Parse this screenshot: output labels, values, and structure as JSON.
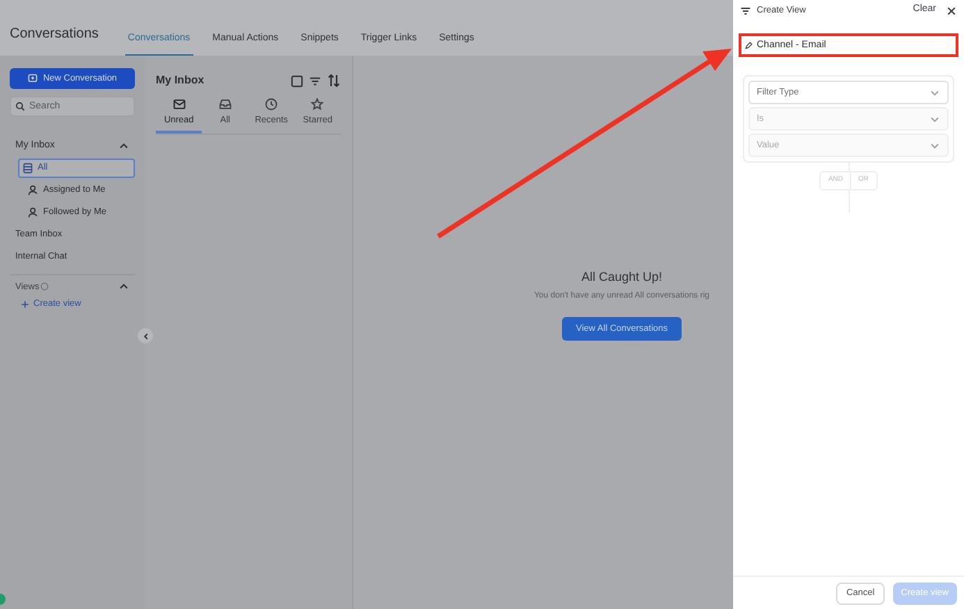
{
  "app": {
    "title": "Conversations"
  },
  "nav_tabs": [
    {
      "label": "Conversations",
      "selected": true
    },
    {
      "label": "Manual Actions",
      "selected": false
    },
    {
      "label": "Snippets",
      "selected": false
    },
    {
      "label": "Trigger Links",
      "selected": false
    },
    {
      "label": "Settings",
      "selected": false
    }
  ],
  "sidebar": {
    "new_button": "New Conversation",
    "search": {
      "placeholder": "Search"
    },
    "my_inbox": {
      "label": "My Inbox",
      "expanded": true,
      "items": [
        {
          "label": "All",
          "kind": "all",
          "selected": true
        },
        {
          "label": "Assigned to Me",
          "kind": "person",
          "selected": false
        },
        {
          "label": "Followed by Me",
          "kind": "person",
          "selected": false
        }
      ]
    },
    "sections": [
      "Team Inbox",
      "Internal Chat"
    ],
    "views": {
      "label": "Views",
      "expanded": true,
      "create": "Create view"
    }
  },
  "inbox": {
    "title": "My Inbox",
    "tabs": [
      {
        "label": "Unread",
        "kind": "mail",
        "selected": true
      },
      {
        "label": "All",
        "kind": "tray",
        "selected": false
      },
      {
        "label": "Recents",
        "kind": "clock",
        "selected": false
      },
      {
        "label": "Starred",
        "kind": "star",
        "selected": false
      }
    ]
  },
  "empty_state": {
    "title": "All Caught Up!",
    "message": "You don't have any unread All conversations rig",
    "button": "View All Conversations"
  },
  "drawer": {
    "title": "Create View",
    "clear": "Clear",
    "name_value": "Channel - Email",
    "filters": [
      {
        "placeholder": "Filter Type",
        "disabled": false
      },
      {
        "placeholder": "Is",
        "disabled": true
      },
      {
        "placeholder": "Value",
        "disabled": true
      }
    ],
    "logic": [
      {
        "label": "AND",
        "selected": false
      },
      {
        "label": "OR",
        "selected": false
      }
    ],
    "cancel": "Cancel",
    "create": {
      "label": "Create view",
      "disabled": true
    }
  }
}
